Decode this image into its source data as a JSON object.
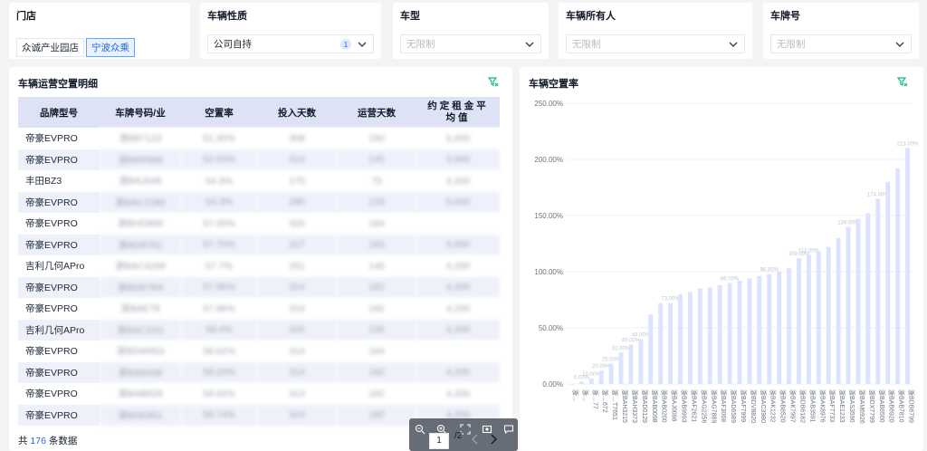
{
  "filters": {
    "store": {
      "label": "门店",
      "options": [
        "众诚产业园店",
        "宁波众乘"
      ],
      "selected_index": 1
    },
    "vehicle_nature": {
      "label": "车辆性质",
      "value": "公司自持",
      "badge": "1"
    },
    "vehicle_type": {
      "label": "车型",
      "placeholder": "无限制"
    },
    "vehicle_owner": {
      "label": "车辆所有人",
      "placeholder": "无限制"
    },
    "plate": {
      "label": "车牌号",
      "placeholder": "无限制"
    }
  },
  "detail_table": {
    "title": "车辆运营空置明细",
    "columns": [
      "品牌型号",
      "车牌号码/业",
      "空置率",
      "投入天数",
      "运营天数",
      "约定租金平均值"
    ],
    "rows": [
      [
        "帝豪EVPRO",
        "浙B87123",
        "51.30%",
        "308",
        "150",
        "5,000"
      ],
      [
        "帝豪EVPRO",
        "浙B6R958",
        "52.00%",
        "314",
        "145",
        "3,900"
      ],
      [
        "丰田BZ3",
        "浙BAJ048",
        "54.3%",
        "175",
        "75",
        "4,200"
      ],
      [
        "帝豪EVPRO",
        "浙BAC2280",
        "54.3%",
        "280",
        "133",
        "5,000"
      ],
      [
        "帝豪EVPRO",
        "浙BHD989",
        "57.00%",
        "320",
        "184",
        ""
      ],
      [
        "帝豪EVPRO",
        "浙BD8752",
        "57.70%",
        "317",
        "183",
        "5,000"
      ],
      [
        "吉利几何APro",
        "浙BAC4269",
        "57.7%",
        "251",
        "140",
        "4,200"
      ],
      [
        "帝豪EVPRO",
        "浙BD87R9",
        "57.96%",
        "314",
        "182",
        "4,200"
      ],
      [
        "帝豪EVPRO",
        "浙BAE78",
        "57.96%",
        "314",
        "182",
        "4,200"
      ],
      [
        "吉利几何APro",
        "浙BAC22G",
        "58.4%",
        "320",
        "155",
        "4,200"
      ],
      [
        "帝豪EVPRO",
        "浙BDW953",
        "58.62%",
        "314",
        "184",
        ""
      ],
      [
        "帝豪EVPRO",
        "浙BAB408",
        "59.20%",
        "314",
        "182",
        "4,200"
      ],
      [
        "帝豪EVPRO",
        "浙BAB829",
        "59.62%",
        "314",
        "182",
        "4,200"
      ],
      [
        "帝豪EVPRO",
        "浙BAE851",
        "59.74%",
        "314",
        "182",
        "4,200"
      ]
    ],
    "footer": {
      "prefix": "共",
      "count": "176",
      "suffix": "条数据"
    },
    "pager": {
      "current": "1",
      "total": "/2"
    }
  },
  "chart_data": {
    "type": "bar",
    "title": "车辆空置率",
    "ylim": [
      0,
      250
    ],
    "yticks": [
      "0.00%",
      "50.00%",
      "100.00%",
      "150.00%",
      "200.00%",
      "250.00%"
    ],
    "bar_color": "#dbe3ff",
    "grid": true,
    "categories": [
      "浙…",
      "浙…",
      "浙…77",
      "浙…672",
      "浙…T7651",
      "浙BAH3215",
      "浙BAH3373",
      "浙BAD0129",
      "浙BAB0098",
      "浙BAB0200",
      "浙BAJ0098",
      "浙BAB9993",
      "浙BAF2621",
      "浙BAG2256",
      "浙BAG7889",
      "浙BAF3068",
      "浙BAD6589",
      "浙BAF7999",
      "浙BDV8820",
      "浙BAC3980",
      "浙BAK1232",
      "浙BAB8520",
      "浙BAK7997",
      "浙BDB6182",
      "浙BAB3591",
      "浙BAK8976",
      "浙BAF7733",
      "浙BAE1233",
      "浙BAS3590",
      "浙BAM6926",
      "浙BDX7799",
      "浙BAB6500",
      "浙BAB6920",
      "浙BAB7810",
      "浙BDB6799"
    ],
    "values": [
      0,
      2,
      5,
      12,
      18,
      28,
      35,
      40,
      62,
      72,
      72,
      80,
      82,
      85,
      86,
      88,
      90,
      92,
      94,
      96,
      98,
      100,
      103,
      112,
      115,
      118,
      122,
      130,
      140,
      147,
      152,
      165,
      180,
      192,
      210
    ],
    "value_labels": [
      "",
      "0.00%",
      "10.00%",
      "20.00%",
      "25.00%",
      "32.00%",
      "40.00%",
      "48.00%",
      "",
      "",
      "73.00%",
      "",
      "",
      "",
      "",
      "",
      "86.00%",
      "",
      "",
      "",
      "96.00%",
      "",
      "",
      "109.00%",
      "112.00%",
      "",
      "",
      "",
      "139.00%",
      "",
      "",
      "174.00%",
      "",
      "",
      "213.00%"
    ]
  }
}
